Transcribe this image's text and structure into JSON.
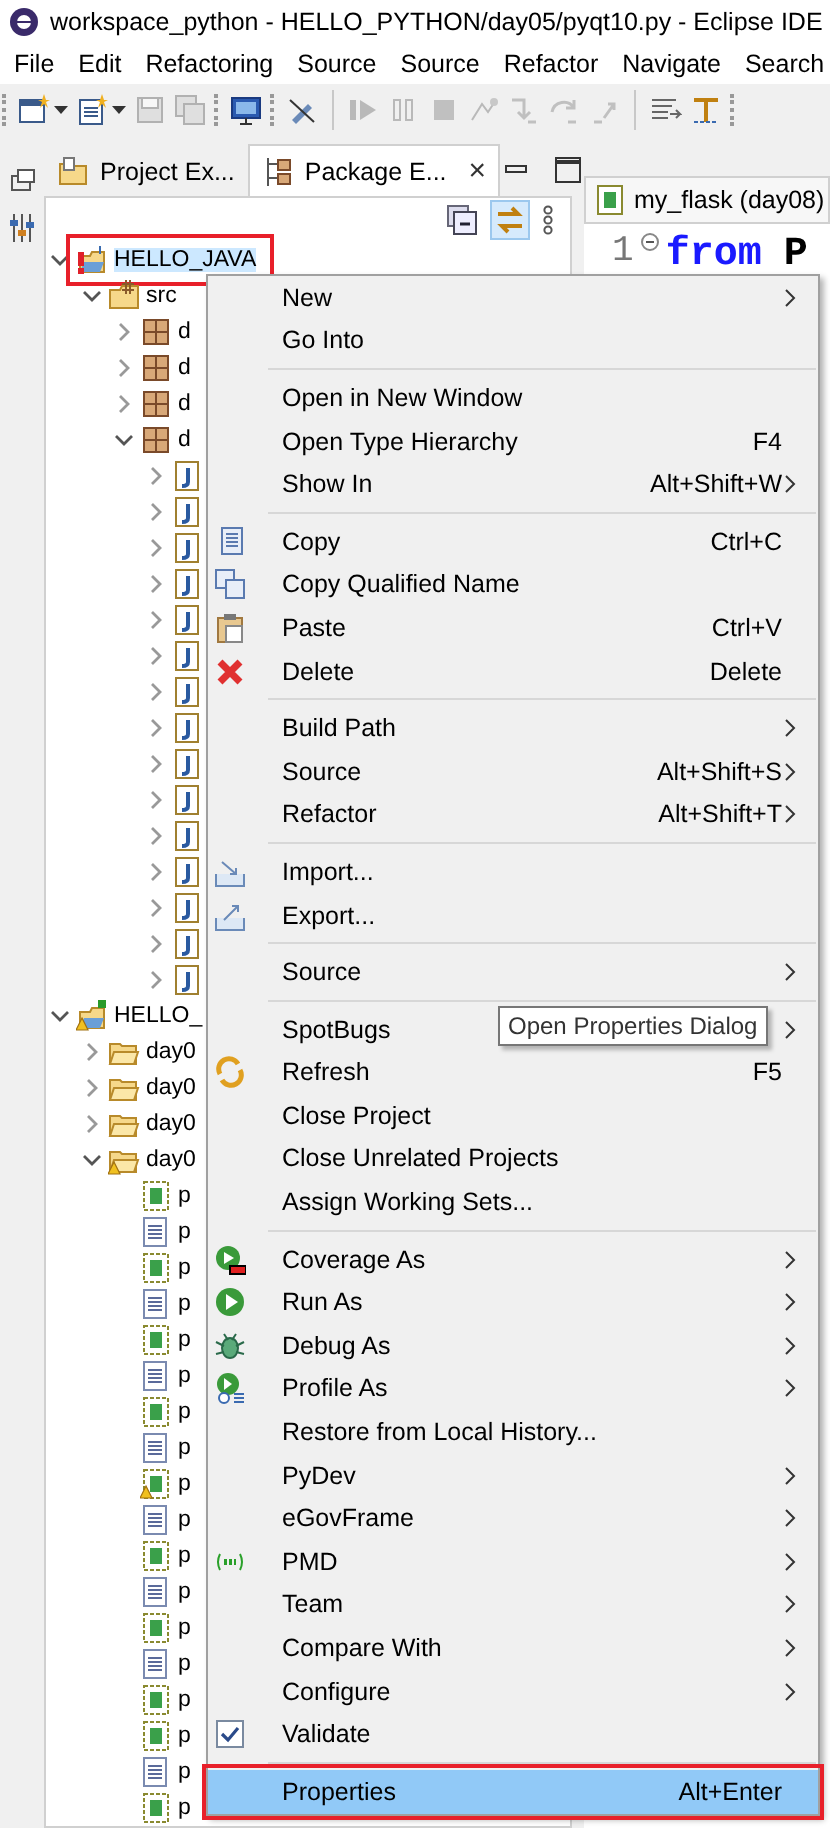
{
  "window": {
    "title": "workspace_python - HELLO_PYTHON/day05/pyqt10.py - Eclipse IDE"
  },
  "menu_bar": [
    "File",
    "Edit",
    "Refactoring",
    "Source",
    "Source",
    "Refactor",
    "Navigate",
    "Search"
  ],
  "toolbar": [
    {
      "kind": "grip"
    },
    {
      "kind": "new-wizard",
      "dropdown": true,
      "disabled": false
    },
    {
      "kind": "new-file",
      "dropdown": true,
      "disabled": false
    },
    {
      "kind": "save",
      "disabled": true
    },
    {
      "kind": "save-all",
      "disabled": true
    },
    {
      "kind": "grip"
    },
    {
      "kind": "monitor",
      "disabled": false
    },
    {
      "kind": "grip"
    },
    {
      "kind": "pen",
      "disabled": false
    },
    {
      "kind": "separator"
    },
    {
      "kind": "resume",
      "disabled": true
    },
    {
      "kind": "suspend",
      "disabled": true
    },
    {
      "kind": "stop",
      "disabled": true
    },
    {
      "kind": "disconnect",
      "disabled": true
    },
    {
      "kind": "step-into",
      "disabled": true
    },
    {
      "kind": "step-over",
      "disabled": true
    },
    {
      "kind": "step-return",
      "disabled": true
    },
    {
      "kind": "separator"
    },
    {
      "kind": "lines",
      "disabled": false
    },
    {
      "kind": "toggle",
      "disabled": false
    },
    {
      "kind": "grip"
    }
  ],
  "view_tabs": [
    {
      "label": "Project Ex...",
      "kind": "project",
      "selected": false
    },
    {
      "label": "Package E...",
      "kind": "package",
      "selected": true,
      "close": "×"
    }
  ],
  "view_toolbar": [
    {
      "kind": "collapse",
      "pressed": false
    },
    {
      "kind": "link",
      "pressed": true
    },
    {
      "kind": "menu",
      "pressed": false
    }
  ],
  "tree": [
    {
      "label": "HELLO_JAVA",
      "kind": "java-project",
      "error": true,
      "expanded": true,
      "selected": true,
      "highlighted": true,
      "children": [
        {
          "label": "src",
          "kind": "source-folder",
          "expanded": true,
          "selected": false,
          "children": [
            {
              "label": "d",
              "kind": "package",
              "expanded": false,
              "selected": false
            },
            {
              "label": "d",
              "kind": "package",
              "expanded": false,
              "selected": false
            },
            {
              "label": "d",
              "kind": "package",
              "expanded": false,
              "selected": false
            },
            {
              "label": "d",
              "kind": "package",
              "expanded": true,
              "selected": false,
              "children": [
                {
                  "kind": "java-file",
                  "expanded": false
                },
                {
                  "kind": "java-file",
                  "expanded": false
                },
                {
                  "kind": "java-file",
                  "expanded": false
                },
                {
                  "kind": "java-file",
                  "expanded": false
                },
                {
                  "kind": "java-file",
                  "expanded": false
                },
                {
                  "kind": "java-file",
                  "expanded": false
                },
                {
                  "kind": "java-file",
                  "expanded": false
                },
                {
                  "kind": "java-file",
                  "expanded": false
                },
                {
                  "kind": "java-file",
                  "expanded": false
                },
                {
                  "kind": "java-file",
                  "expanded": false
                },
                {
                  "kind": "java-file",
                  "expanded": false
                },
                {
                  "kind": "java-file",
                  "expanded": false
                },
                {
                  "kind": "java-file",
                  "expanded": false
                },
                {
                  "kind": "java-file",
                  "expanded": false
                },
                {
                  "kind": "java-file",
                  "expanded": false
                }
              ]
            }
          ]
        }
      ]
    },
    {
      "label": "HELLO_",
      "kind": "python-project",
      "warning": true,
      "expanded": true,
      "selected": false,
      "children": [
        {
          "label": "day0",
          "kind": "folder",
          "expanded": false,
          "selected": false
        },
        {
          "label": "day0",
          "kind": "folder",
          "expanded": false,
          "selected": false
        },
        {
          "label": "day0",
          "kind": "folder",
          "expanded": false,
          "selected": false
        },
        {
          "label": "day0",
          "kind": "folder",
          "warning": true,
          "expanded": true,
          "selected": false,
          "children": [
            {
              "label": "p",
              "kind": "python-file",
              "selected": false
            },
            {
              "label": "p",
              "kind": "text-file",
              "selected": false
            },
            {
              "label": "p",
              "kind": "python-file",
              "selected": false
            },
            {
              "label": "p",
              "kind": "text-file",
              "selected": false
            },
            {
              "label": "p",
              "kind": "python-file",
              "selected": false
            },
            {
              "label": "p",
              "kind": "text-file",
              "selected": false
            },
            {
              "label": "p",
              "kind": "python-file",
              "selected": false
            },
            {
              "label": "p",
              "kind": "text-file",
              "selected": false
            },
            {
              "label": "p",
              "kind": "python-file",
              "warning": true,
              "selected": false
            },
            {
              "label": "p",
              "kind": "text-file",
              "selected": false
            },
            {
              "label": "p",
              "kind": "python-file",
              "selected": false
            },
            {
              "label": "p",
              "kind": "text-file",
              "selected": false
            },
            {
              "label": "p",
              "kind": "python-file",
              "selected": false
            },
            {
              "label": "p",
              "kind": "text-file",
              "selected": false
            },
            {
              "label": "p",
              "kind": "python-file",
              "selected": false
            },
            {
              "label": "p",
              "kind": "python-file",
              "selected": false
            },
            {
              "label": "p",
              "kind": "text-file",
              "selected": false
            },
            {
              "label": "p",
              "kind": "python-file",
              "selected": false
            }
          ]
        }
      ]
    }
  ],
  "editor": {
    "tab": "my_flask (day08)",
    "line_number": "1",
    "tokens": [
      {
        "text": "from",
        "kind": "keyword"
      },
      {
        "text": "P",
        "kind": "name"
      }
    ]
  },
  "context_menu": [
    {
      "kind": "item",
      "label": "New",
      "submenu": true,
      "selected": false
    },
    {
      "kind": "item",
      "label": "Go Into",
      "selected": false
    },
    {
      "kind": "separator"
    },
    {
      "kind": "item",
      "label": "Open in New Window",
      "selected": false
    },
    {
      "kind": "item",
      "label": "Open Type Hierarchy",
      "shortcut": "F4",
      "selected": false
    },
    {
      "kind": "item",
      "label": "Show In",
      "shortcut": "Alt+Shift+W",
      "submenu": true,
      "selected": false
    },
    {
      "kind": "separator"
    },
    {
      "kind": "copy",
      "label": "Copy",
      "shortcut": "Ctrl+C",
      "selected": false
    },
    {
      "kind": "copy-name",
      "label": "Copy Qualified Name",
      "selected": false
    },
    {
      "kind": "paste",
      "label": "Paste",
      "shortcut": "Ctrl+V",
      "selected": false
    },
    {
      "kind": "delete",
      "label": "Delete",
      "shortcut": "Delete",
      "selected": false
    },
    {
      "kind": "separator"
    },
    {
      "kind": "item",
      "label": "Build Path",
      "submenu": true,
      "selected": false
    },
    {
      "kind": "item",
      "label": "Source",
      "shortcut": "Alt+Shift+S",
      "submenu": true,
      "selected": false
    },
    {
      "kind": "item",
      "label": "Refactor",
      "shortcut": "Alt+Shift+T",
      "submenu": true,
      "selected": false
    },
    {
      "kind": "separator"
    },
    {
      "kind": "import",
      "label": "Import...",
      "selected": false
    },
    {
      "kind": "export",
      "label": "Export...",
      "selected": false
    },
    {
      "kind": "separator"
    },
    {
      "kind": "item",
      "label": "Source",
      "submenu": true,
      "selected": false
    },
    {
      "kind": "separator"
    },
    {
      "kind": "item",
      "label": "SpotBugs",
      "submenu": true,
      "selected": false,
      "tooltip": "Open Properties Dialog"
    },
    {
      "kind": "refresh",
      "label": "Refresh",
      "shortcut": "F5",
      "selected": false
    },
    {
      "kind": "item",
      "label": "Close Project",
      "selected": false
    },
    {
      "kind": "item",
      "label": "Close Unrelated Projects",
      "selected": false
    },
    {
      "kind": "item",
      "label": "Assign Working Sets...",
      "selected": false
    },
    {
      "kind": "separator"
    },
    {
      "kind": "coverage",
      "label": "Coverage As",
      "submenu": true,
      "selected": false
    },
    {
      "kind": "run",
      "label": "Run As",
      "submenu": true,
      "selected": false
    },
    {
      "kind": "debug",
      "label": "Debug As",
      "submenu": true,
      "selected": false
    },
    {
      "kind": "profile",
      "label": "Profile As",
      "submenu": true,
      "selected": false
    },
    {
      "kind": "item",
      "label": "Restore from Local History...",
      "selected": false
    },
    {
      "kind": "item",
      "label": "PyDev",
      "submenu": true,
      "selected": false
    },
    {
      "kind": "item",
      "label": "eGovFrame",
      "submenu": true,
      "selected": false
    },
    {
      "kind": "pmd",
      "label": "PMD",
      "submenu": true,
      "selected": false
    },
    {
      "kind": "item",
      "label": "Team",
      "submenu": true,
      "selected": false
    },
    {
      "kind": "item",
      "label": "Compare With",
      "submenu": true,
      "selected": false
    },
    {
      "kind": "item",
      "label": "Configure",
      "submenu": true,
      "selected": false
    },
    {
      "kind": "check",
      "label": "Validate",
      "checked": true,
      "selected": false
    },
    {
      "kind": "separator"
    },
    {
      "kind": "item",
      "label": "Properties",
      "shortcut": "Alt+Enter",
      "selected": true,
      "highlighted": true
    }
  ]
}
